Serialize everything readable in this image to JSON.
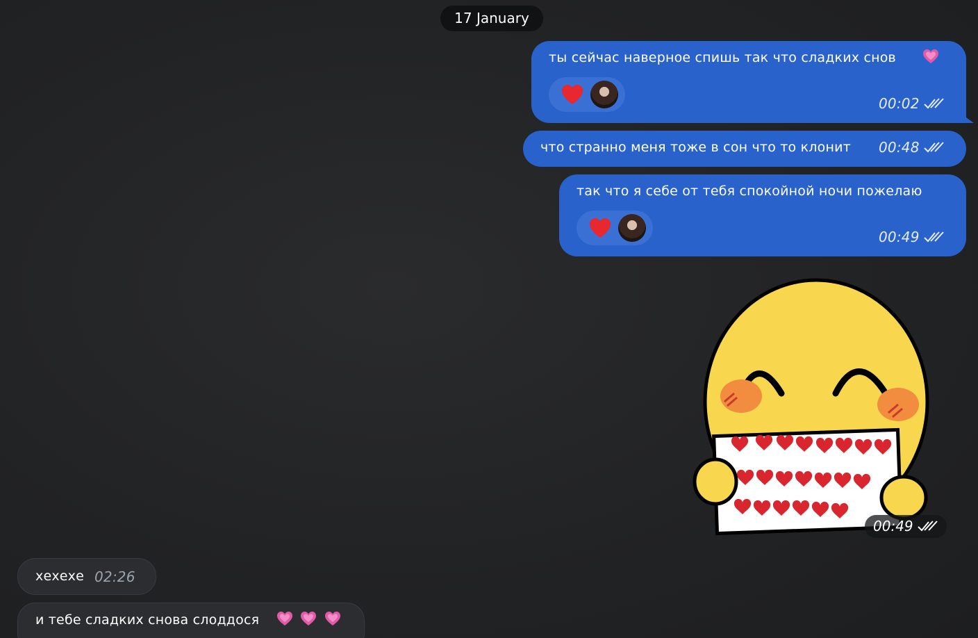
{
  "date_separator": "17 January",
  "messages": [
    {
      "direction": "out",
      "text": "ты сейчас наверное спишь так что сладких снов",
      "emoji": "pink-heart",
      "time": "00:02",
      "status": "read",
      "reaction": "red-heart"
    },
    {
      "direction": "out",
      "text": "что странно меня тоже в сон что то клонит",
      "time": "00:48",
      "status": "read"
    },
    {
      "direction": "out",
      "text": "так что я себе от тебя спокойной ночи пожелаю",
      "time": "00:49",
      "status": "read",
      "reaction": "red-heart"
    },
    {
      "direction": "out",
      "type": "sticker",
      "sticker": "smiling-face-holding-hearts-sign",
      "time": "00:49",
      "status": "read"
    },
    {
      "direction": "in",
      "text": "хехехе",
      "time": "02:26"
    },
    {
      "direction": "in",
      "text": "и тебе сладких снова слоддося",
      "emoji": "pink-heart x3"
    }
  ],
  "colors": {
    "background": "#1f2022",
    "outgoing_bubble": "#2a62cc",
    "incoming_bubble": "#2c2d30",
    "date_pill": "#111214",
    "reaction_bg": "#3a6fd4"
  }
}
